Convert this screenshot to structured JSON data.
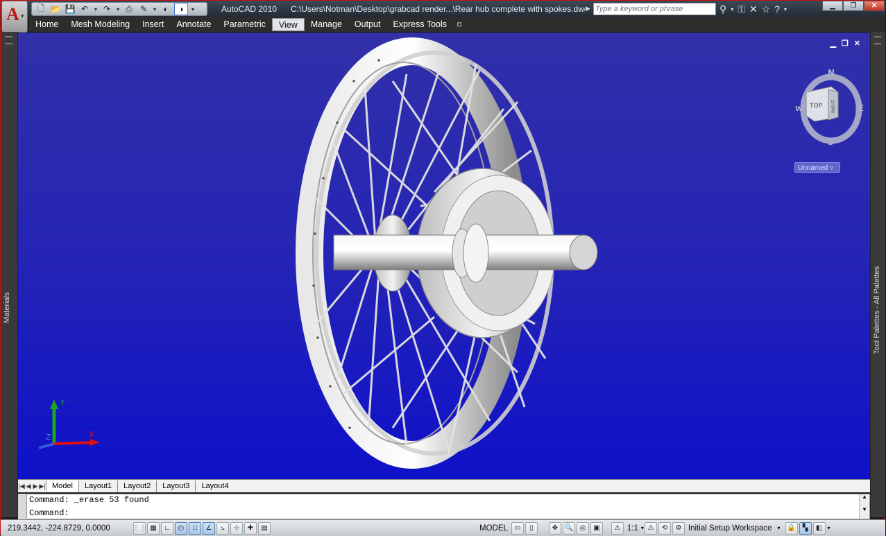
{
  "titlebar": {
    "app_title": "AutoCAD 2010",
    "document_title": "C:\\Users\\Notman\\Desktop\\grabcad render...\\Rear hub complete with spokes.dwg",
    "search_placeholder": "Type a keyword or phrase",
    "qat_icons": [
      "new-icon",
      "open-icon",
      "save-icon",
      "undo-icon",
      "redo-icon",
      "plot-icon",
      "publish-icon",
      "workspace-icon"
    ],
    "info_icons": [
      "binoculars-icon",
      "key-icon",
      "tools-icon",
      "star-icon",
      "help-icon"
    ]
  },
  "menu": {
    "items": [
      "Home",
      "Mesh Modeling",
      "Insert",
      "Annotate",
      "Parametric",
      "View",
      "Manage",
      "Output",
      "Express Tools"
    ],
    "active": "View"
  },
  "palettes": {
    "left_label": "Materials",
    "right_label": "Tool Palettes - All Palettes"
  },
  "viewcube": {
    "north": "N",
    "south": "S",
    "east": "E",
    "west": "W",
    "face_top": "TOP",
    "face_right": "RIGHT",
    "ucs_name": "Unnamed"
  },
  "ucs": {
    "x": "X",
    "y": "Y",
    "z": "Z"
  },
  "layout_tabs": [
    "Model",
    "Layout1",
    "Layout2",
    "Layout3",
    "Layout4"
  ],
  "active_tab": "Model",
  "command": {
    "history": "Command:  _erase 53 found",
    "prompt": "Command:"
  },
  "status": {
    "coordinates": "219.3442, -224.8729, 0.0000",
    "model_label": "MODEL",
    "annotation_scale": "1:1",
    "workspace": "Initial Setup Workspace"
  },
  "colors": {
    "viewport_top": "#3130a8",
    "viewport_bottom": "#0e11c8",
    "accent_red": "#c41010"
  }
}
